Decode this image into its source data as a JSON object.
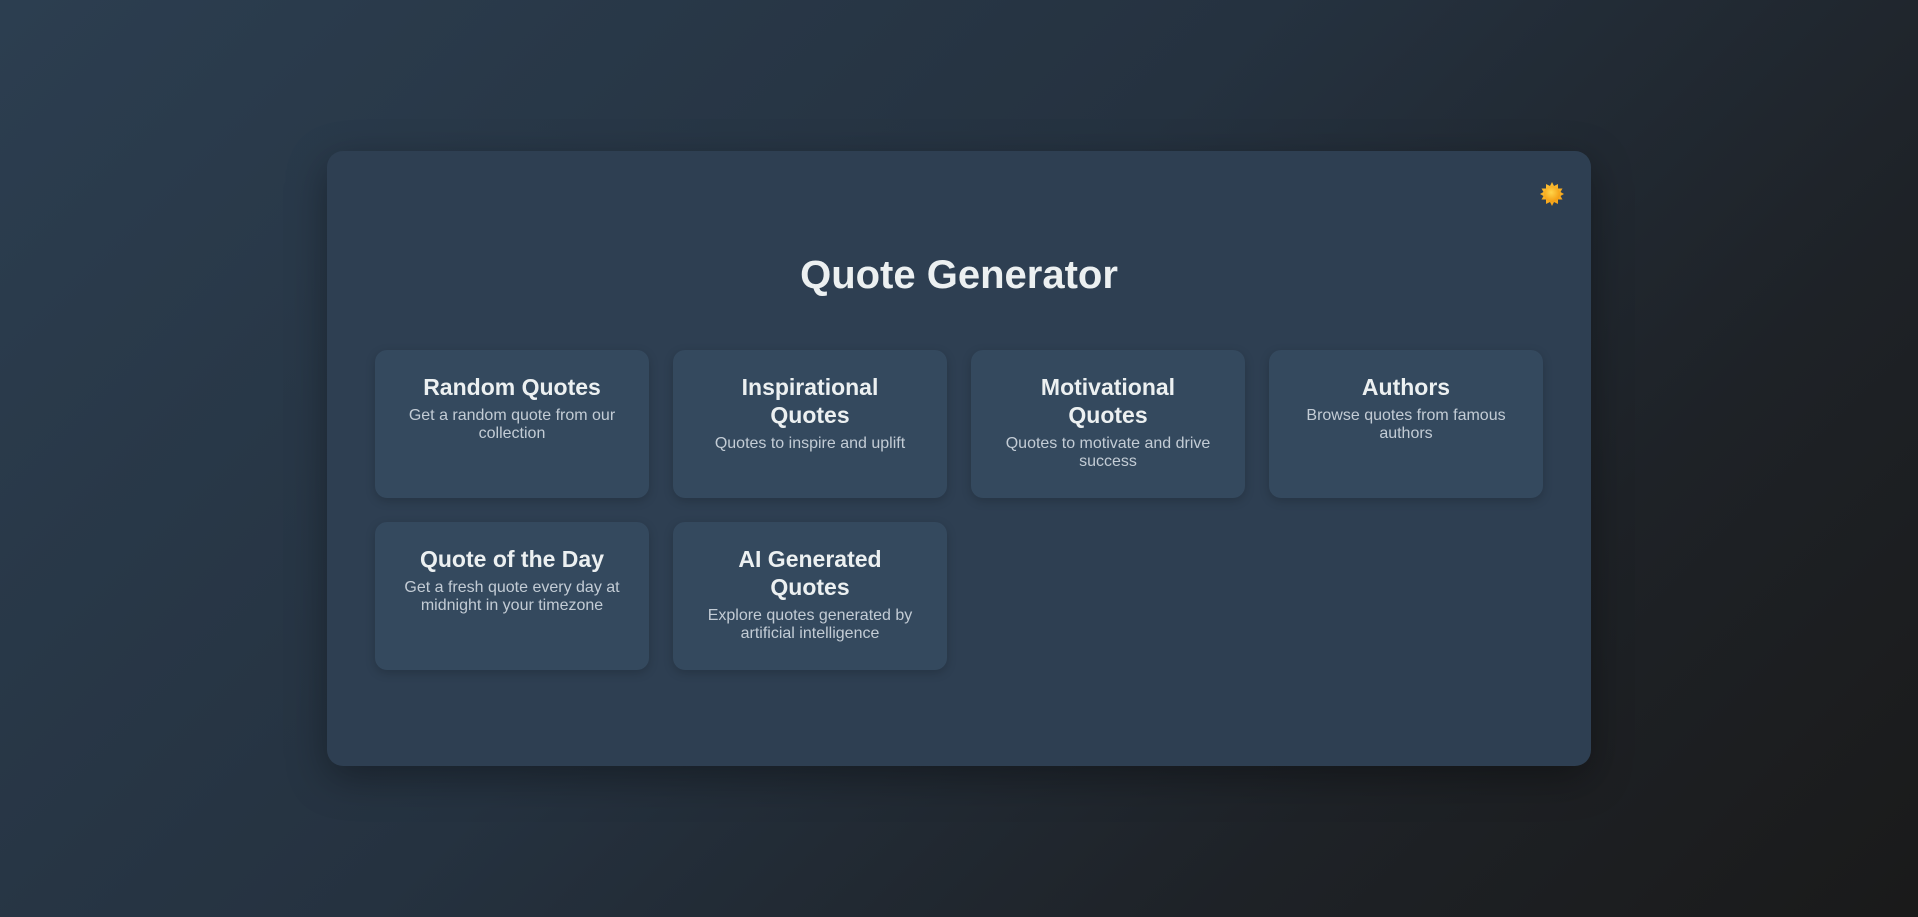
{
  "app": {
    "title": "Quote Generator",
    "theme_toggle_icon": "sun-icon"
  },
  "colors": {
    "panel_bg": "#2e3f52",
    "card_bg": "#34495e",
    "text_primary": "#ecf0f1",
    "text_secondary": "#c3ccd5",
    "sun_accent": "#f5b82e"
  },
  "cards": [
    {
      "title": "Random Quotes",
      "description": "Get a random quote from our collection"
    },
    {
      "title": "Inspirational Quotes",
      "description": "Quotes to inspire and uplift"
    },
    {
      "title": "Motivational Quotes",
      "description": "Quotes to motivate and drive success"
    },
    {
      "title": "Authors",
      "description": "Browse quotes from famous authors"
    },
    {
      "title": "Quote of the Day",
      "description": "Get a fresh quote every day at midnight in your timezone"
    },
    {
      "title": "AI Generated Quotes",
      "description": "Explore quotes generated by artificial intelligence"
    }
  ]
}
